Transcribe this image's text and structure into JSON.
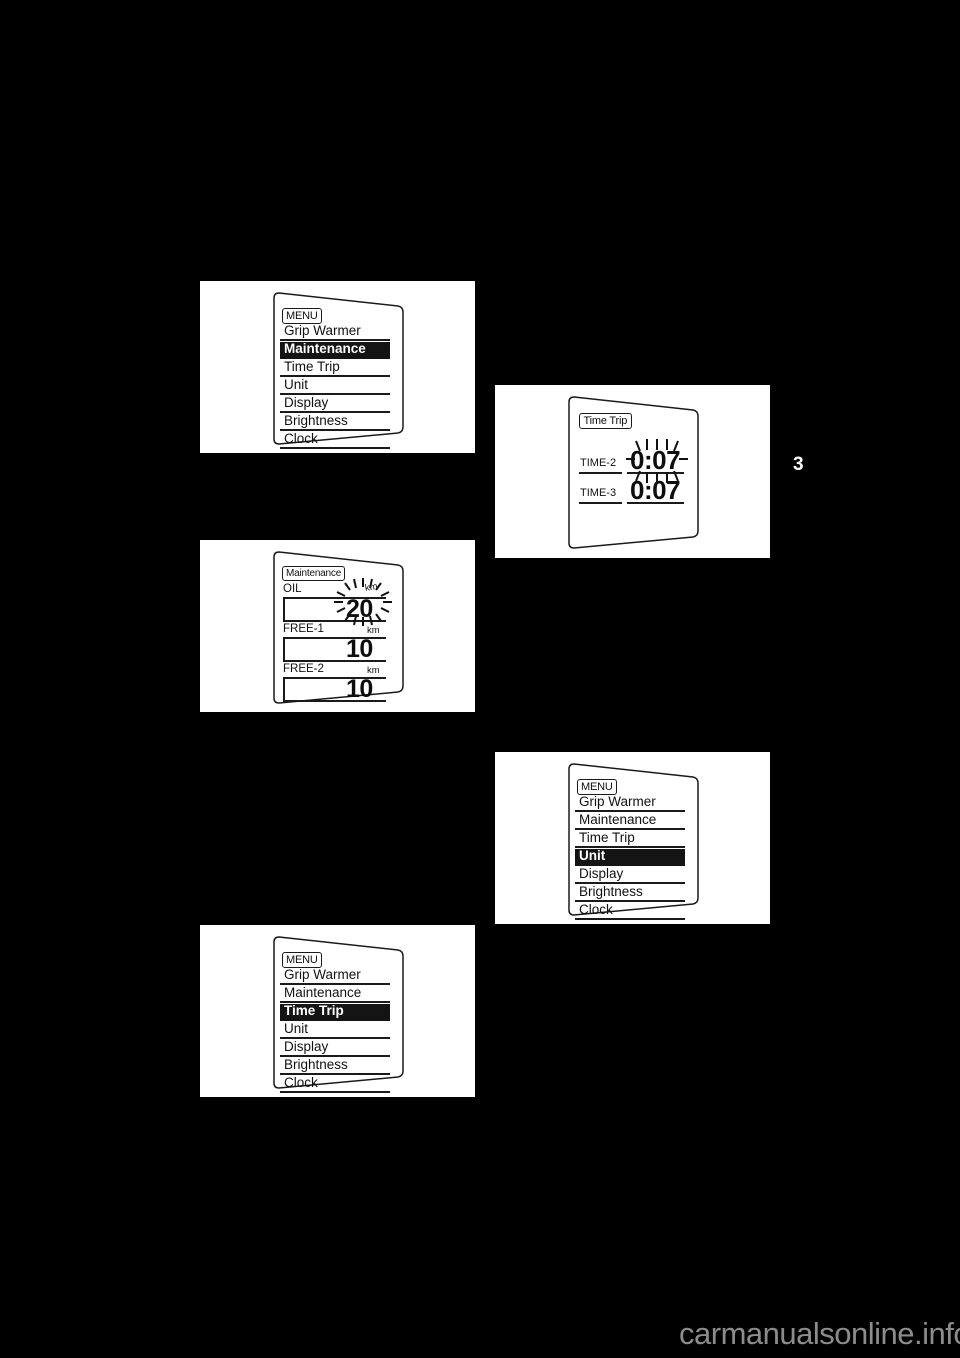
{
  "page": {
    "number": "3",
    "watermark": "carmanualsonline.info",
    "background_color": "#000000",
    "plate_color": "#ffffff",
    "ink_color": "#111111",
    "highlight_color": "#141414",
    "watermark_color": "#8c8c8c"
  },
  "figures": [
    {
      "id": "menu-maintenance-selected",
      "type": "menu",
      "header": "MENU",
      "items": [
        {
          "label": "Grip Warmer",
          "selected": false
        },
        {
          "label": "Maintenance",
          "selected": true
        },
        {
          "label": "Time Trip",
          "selected": false
        },
        {
          "label": "Unit",
          "selected": false
        },
        {
          "label": "Display",
          "selected": false
        },
        {
          "label": "Brightness",
          "selected": false
        },
        {
          "label": "Clock",
          "selected": false
        }
      ]
    },
    {
      "id": "maintenance-screen",
      "type": "values",
      "header": "Maintenance",
      "rows": [
        {
          "label": "OIL",
          "unit": "km",
          "value": "20",
          "blinking": true
        },
        {
          "label": "FREE-1",
          "unit": "km",
          "value": "10",
          "blinking": false
        },
        {
          "label": "FREE-2",
          "unit": "km",
          "value": "10",
          "blinking": false
        }
      ]
    },
    {
      "id": "menu-timetrip-selected",
      "type": "menu",
      "header": "MENU",
      "items": [
        {
          "label": "Grip Warmer",
          "selected": false
        },
        {
          "label": "Maintenance",
          "selected": false
        },
        {
          "label": "Time Trip",
          "selected": true
        },
        {
          "label": "Unit",
          "selected": false
        },
        {
          "label": "Display",
          "selected": false
        },
        {
          "label": "Brightness",
          "selected": false
        },
        {
          "label": "Clock",
          "selected": false
        }
      ]
    },
    {
      "id": "time-trip-screen",
      "type": "values",
      "header": "Time Trip",
      "rows": [
        {
          "label": "TIME-2",
          "unit": "",
          "value": "0:07",
          "blinking": true
        },
        {
          "label": "TIME-3",
          "unit": "",
          "value": "0:07",
          "blinking": false
        }
      ]
    },
    {
      "id": "menu-unit-selected",
      "type": "menu",
      "header": "MENU",
      "items": [
        {
          "label": "Grip Warmer",
          "selected": false
        },
        {
          "label": "Maintenance",
          "selected": false
        },
        {
          "label": "Time Trip",
          "selected": false
        },
        {
          "label": "Unit",
          "selected": true
        },
        {
          "label": "Display",
          "selected": false
        },
        {
          "label": "Brightness",
          "selected": false
        },
        {
          "label": "Clock",
          "selected": false
        }
      ]
    }
  ]
}
